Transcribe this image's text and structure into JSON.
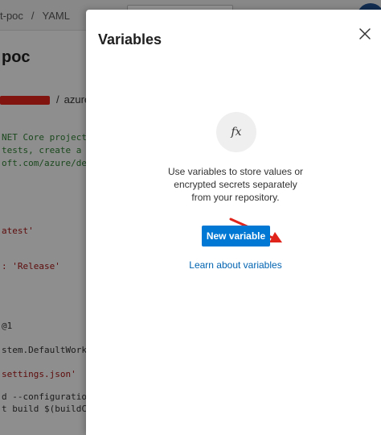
{
  "background": {
    "breadcrumbs": [
      "t-poc",
      "/",
      "YAML"
    ],
    "page_title": "poc",
    "repo_path": {
      "separator": "/",
      "segment": "azure"
    },
    "code_lines": [
      {
        "text": "NET Core projects",
        "color": "green"
      },
      {
        "text": "tests, create a N",
        "color": "green"
      },
      {
        "text": "oft.com/azure/dev",
        "color": "green"
      },
      {
        "text": "atest'",
        "color": "red"
      },
      {
        "text": ": 'Release'",
        "color": "red"
      },
      {
        "text": "@1",
        "color": "dark"
      },
      {
        "text": "stem.DefaultWorki",
        "color": "dark"
      },
      {
        "text": "settings.json'",
        "color": "red"
      },
      {
        "text": "d --configuration",
        "color": "dark"
      },
      {
        "text": "t build $(buildCo",
        "color": "dark"
      }
    ]
  },
  "panel": {
    "title": "Variables",
    "close_icon": "close-icon",
    "fx_label": "fx",
    "empty_state_text": "Use variables to store values or encrypted secrets separately from your repository.",
    "new_variable_label": "New variable",
    "learn_link_label": "Learn about variables",
    "accent_color": "#0078d4",
    "annotation_arrow_color": "#e0231b"
  }
}
